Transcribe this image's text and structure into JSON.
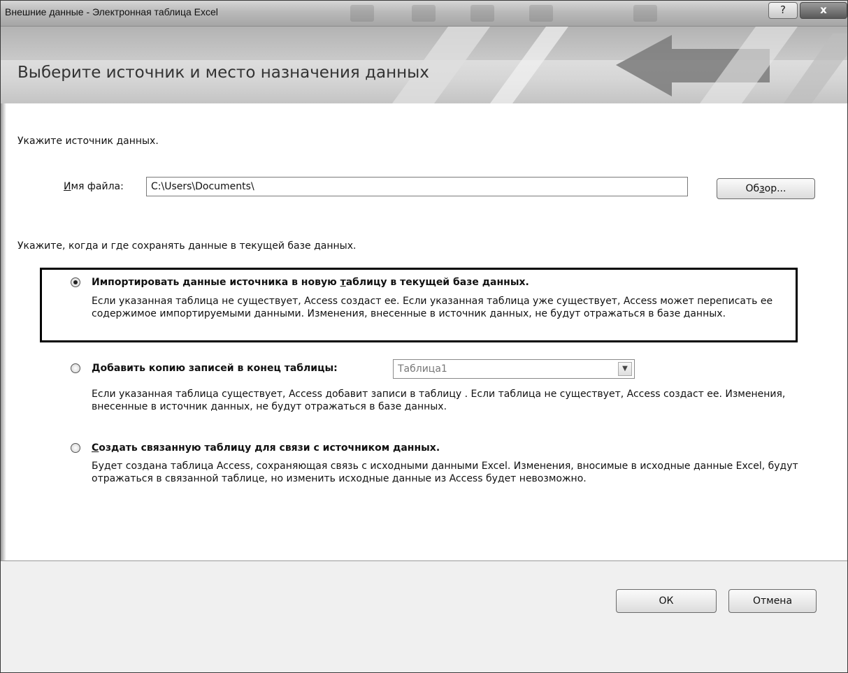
{
  "window": {
    "title": "Внешние данные - Электронная таблица Excel",
    "help_label": "?",
    "close_label": "x"
  },
  "header": {
    "title": "Выберите источник и место назначения данных"
  },
  "source": {
    "prompt": "Укажите источник данных.",
    "file_label_accel": "И",
    "file_label_rest": "мя файла:",
    "file_value": "C:\\Users\\Documents\\",
    "browse_pre": "Об",
    "browse_accel": "з",
    "browse_post": "ор..."
  },
  "storage": {
    "prompt": "Укажите, когда и где сохранять данные в текущей базе данных."
  },
  "options": {
    "import": {
      "title_pre": "Импортировать данные источника в новую ",
      "title_accel": "т",
      "title_post": "аблицу в текущей базе данных.",
      "description": "Если указанная таблица не существует, Access создаст ее. Если указанная таблица уже существует, Access может переписать ее содержимое импортируемыми данными. Изменения, внесенные в источник данных, не будут отражаться в базе данных.",
      "selected": true
    },
    "append": {
      "title_accel": "Д",
      "title_rest": "обавить копию записей в конец таблицы:",
      "table_value": "Таблица1",
      "description": "Если указанная таблица существует, Access добавит записи в таблицу . Если таблица не существует, Access создаст ее. Изменения, внесенные в источник данных, не будут отражаться в базе данных.",
      "selected": false
    },
    "link": {
      "title_accel": "С",
      "title_rest": "оздать связанную таблицу для связи с источником данных.",
      "description": "Будет создана таблица Access, сохраняющая связь с исходными данными Excel. Изменения, вносимые в исходные данные Excel, будут отражаться в связанной таблице, но изменить исходные данные из Access будет невозможно.",
      "selected": false
    }
  },
  "footer": {
    "ok_label": "ОК",
    "cancel_label": "Отмена"
  }
}
